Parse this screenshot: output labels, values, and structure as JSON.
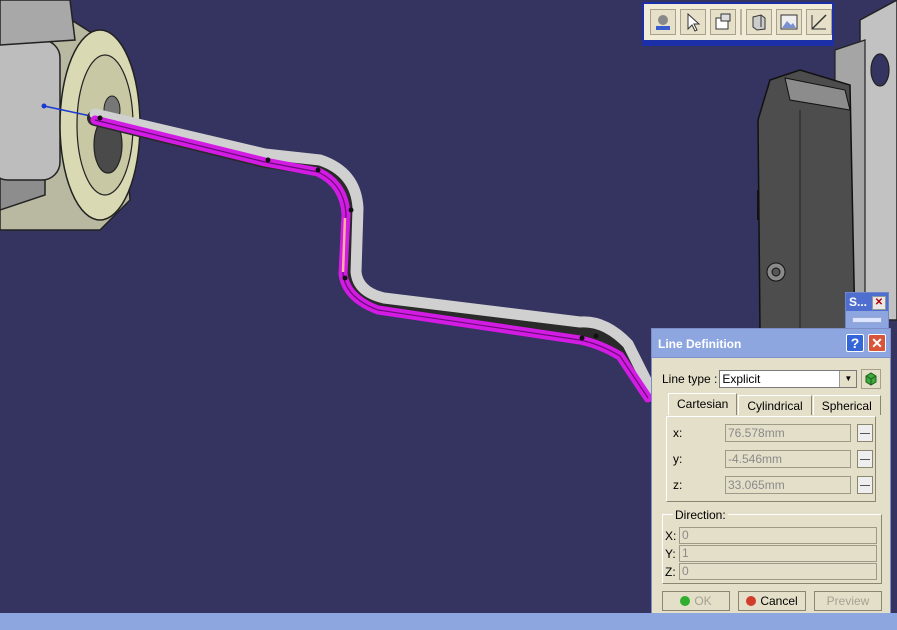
{
  "toolbar": {
    "icons": [
      "part-view-icon",
      "select-arrow-icon",
      "properties-icon",
      "cube-view-icon",
      "picture-icon",
      "draft-icon"
    ]
  },
  "small_window": {
    "title": "S...",
    "close": "✕"
  },
  "dialog": {
    "title": "Line Definition",
    "help": "?",
    "close": "✕",
    "line_type_label": "Line type :",
    "line_type_value": "Explicit",
    "tabs": [
      "Cartesian",
      "Cylindrical",
      "Spherical"
    ],
    "active_tab": "Cartesian",
    "fields": [
      {
        "label": "x:",
        "value": "76.578mm"
      },
      {
        "label": "y:",
        "value": "-4.546mm"
      },
      {
        "label": "z:",
        "value": "33.065mm"
      }
    ],
    "direction": {
      "legend": "Direction:",
      "rows": [
        {
          "label": "X:",
          "value": "0"
        },
        {
          "label": "Y:",
          "value": "1"
        },
        {
          "label": "Z:",
          "value": "0"
        }
      ]
    },
    "buttons": {
      "ok": "OK",
      "cancel": "Cancel",
      "preview": "Preview"
    }
  },
  "colors": {
    "background": "#35335f",
    "pipe_highlight": "#d21ce3",
    "pipe_body": "#c9c9c9",
    "dialog_title": "#8ea6e0",
    "ok_dot": "#2fae2f",
    "cancel_dot": "#d23c2c"
  }
}
